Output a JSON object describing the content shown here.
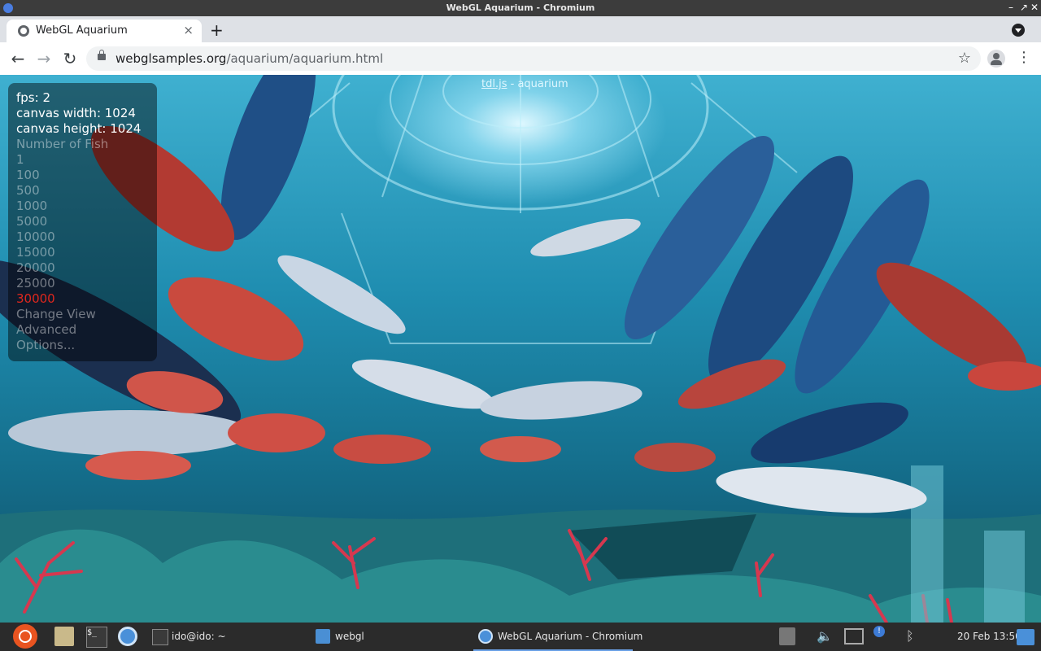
{
  "os_window": {
    "title": "WebGL Aquarium - Chromium"
  },
  "browser": {
    "tab": {
      "title": "WebGL Aquarium",
      "close_glyph": "×"
    },
    "new_tab_glyph": "+",
    "url_host": "webglsamples.org",
    "url_path": "/aquarium/aquarium.html",
    "icons": {
      "back": "←",
      "forward": "→",
      "reload": "↻",
      "bookmark": "☆",
      "menu": "⋮"
    }
  },
  "aquarium": {
    "credit_link": "tdl.js",
    "credit_rest": " - aquarium",
    "stats": {
      "fps": "fps: 2",
      "canvas_width": "canvas width: 1024",
      "canvas_height": "canvas height: 1024"
    },
    "number_of_fish_label": "Number of Fish",
    "fish_options": [
      "1",
      "100",
      "500",
      "1000",
      "5000",
      "10000",
      "15000",
      "20000",
      "25000",
      "30000"
    ],
    "selected_fish_option": "30000",
    "menu": {
      "change_view": "Change View",
      "advanced": "Advanced",
      "options": "Options..."
    },
    "colors": {
      "selected": "#e0271d",
      "water": "#1f8db0"
    }
  },
  "taskbar": {
    "terminal_glyph": "$_",
    "tasks": [
      {
        "label": "ido@ido: ~",
        "icon": "terminal-icon"
      },
      {
        "label": "webgl",
        "icon": "folder-icon"
      },
      {
        "label": "WebGL Aquarium - Chromium",
        "icon": "chromium-icon",
        "active": true
      }
    ],
    "clock": "20 Feb 13:50"
  }
}
